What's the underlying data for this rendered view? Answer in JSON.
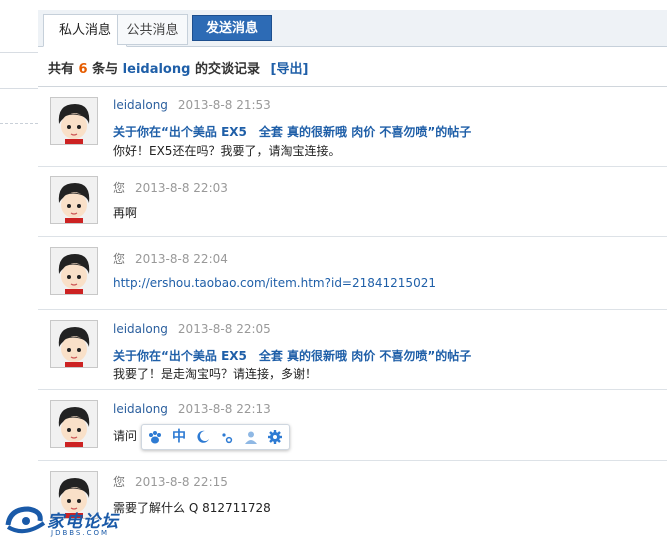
{
  "tabs": {
    "private": "私人消息",
    "public": "公共消息",
    "send": "发送消息"
  },
  "summary": {
    "prefix": "共有",
    "count": "6",
    "mid": "条与",
    "user": "leidalong",
    "suffix": "的交谈记录",
    "export": "[导出]"
  },
  "messages": [
    {
      "sender": "leidalong",
      "time": "2013-8-8 21:53",
      "thread": "关于你在“出个美品 EX5　全套 真的很新哦 肉价 不喜勿喷”的帖子",
      "text": "你好！EX5还在吗？我要了，请淘宝连接。"
    },
    {
      "sender": "您",
      "time": "2013-8-8 22:03",
      "text": "再啊"
    },
    {
      "sender": "您",
      "time": "2013-8-8 22:04",
      "text": "http://ershou.taobao.com/item.htm?id=21841215021"
    },
    {
      "sender": "leidalong",
      "time": "2013-8-8 22:05",
      "thread": "关于你在“出个美品 EX5　全套 真的很新哦 肉价 不喜勿喷”的帖子",
      "text": "我要了！是走淘宝吗？请连接，多谢！"
    },
    {
      "sender": "leidalong",
      "time": "2013-8-8 22:13",
      "text": "请问"
    },
    {
      "sender": "您",
      "time": "2013-8-8 22:15",
      "text": "需要了解什么 Q 812711728"
    }
  ],
  "ime": {
    "icons": [
      "paw-icon",
      "chinese-mode-icon",
      "moon-icon",
      "punctuation-icon",
      "user-icon",
      "gear-icon"
    ],
    "mode_label": "中"
  },
  "watermark": {
    "text": "家电论坛",
    "sub": "JDBBS.COM"
  },
  "colors": {
    "accent": "#2d6bb5",
    "link": "#1f5fa8",
    "count": "#e65c00"
  }
}
